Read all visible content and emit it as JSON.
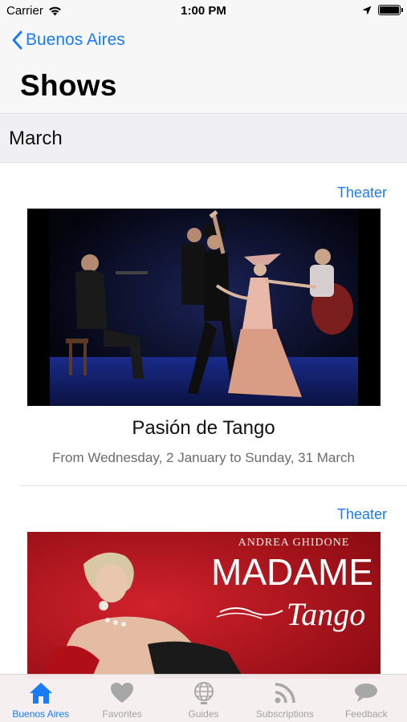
{
  "status_bar": {
    "carrier": "Carrier",
    "time": "1:00 PM",
    "battery_level": 1.0
  },
  "nav": {
    "back_label": "Buenos Aires",
    "title": "Shows"
  },
  "section": {
    "header": "March"
  },
  "shows": [
    {
      "category": "Theater",
      "title": "Pasión de Tango",
      "dates": "From Wednesday, 2 January to Sunday, 31 March",
      "image": "tango-dancers-on-stage-photo"
    },
    {
      "category": "Theater",
      "poster": {
        "credit": "ANDREA GHIDONE",
        "title_line_1": "MADAME",
        "title_line_2": "Tango"
      },
      "image": "madame-tango-poster-photo"
    }
  ],
  "tab_bar": {
    "tabs": [
      {
        "label": "Buenos Aires",
        "icon": "home-icon",
        "active": true
      },
      {
        "label": "Favorites",
        "icon": "heart-icon",
        "active": false
      },
      {
        "label": "Guides",
        "icon": "globe-icon",
        "active": false
      },
      {
        "label": "Subscriptions",
        "icon": "rss-icon",
        "active": false
      },
      {
        "label": "Feedback",
        "icon": "speech-bubble-icon",
        "active": false
      }
    ]
  },
  "colors": {
    "accent": "#1a7cf5",
    "tab_inactive": "#a2a2a2",
    "poster_red": "#c1121f"
  }
}
